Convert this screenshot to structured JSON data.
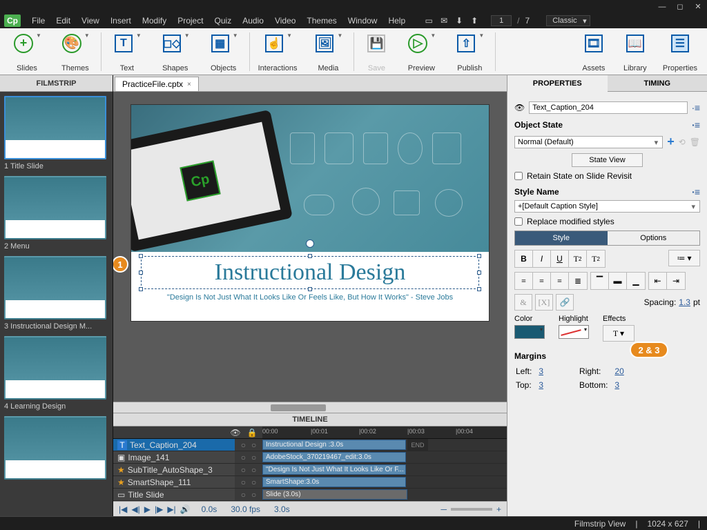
{
  "menu": [
    "File",
    "Edit",
    "View",
    "Insert",
    "Modify",
    "Project",
    "Quiz",
    "Audio",
    "Video",
    "Themes",
    "Window",
    "Help"
  ],
  "page_current": "1",
  "page_total": "7",
  "workspace": "Classic",
  "ribbon": [
    {
      "icon": "plus",
      "label": "Slides",
      "dd": true,
      "style": "circ"
    },
    {
      "icon": "palette",
      "label": "Themes",
      "dd": true,
      "style": "circ"
    },
    {
      "sep": true
    },
    {
      "icon": "T",
      "label": "Text",
      "dd": true,
      "style": "sq"
    },
    {
      "icon": "shapes",
      "label": "Shapes",
      "dd": true,
      "style": "sq"
    },
    {
      "icon": "grid",
      "label": "Objects",
      "dd": true,
      "style": "sq"
    },
    {
      "sep": true
    },
    {
      "icon": "hand",
      "label": "Interactions",
      "dd": true,
      "style": "sq"
    },
    {
      "icon": "img",
      "label": "Media",
      "dd": true,
      "style": "sq"
    },
    {
      "sep": true
    },
    {
      "icon": "save",
      "label": "Save",
      "dd": false,
      "style": "sq",
      "disabled": true
    },
    {
      "icon": "play",
      "label": "Preview",
      "dd": true,
      "style": "circ"
    },
    {
      "icon": "pub",
      "label": "Publish",
      "dd": true,
      "style": "sq"
    },
    {
      "sep": true,
      "flex": true
    },
    {
      "icon": "film",
      "label": "Assets",
      "style": "sq"
    },
    {
      "icon": "book",
      "label": "Library",
      "style": "sq"
    },
    {
      "icon": "menu",
      "label": "Properties",
      "style": "sq",
      "active": true
    }
  ],
  "filmstrip": {
    "header": "FILMSTRIP",
    "slides": [
      {
        "label": "1 Title Slide",
        "sel": true
      },
      {
        "label": "2 Menu"
      },
      {
        "label": "3 Instructional Design M..."
      },
      {
        "label": "4 Learning Design"
      }
    ]
  },
  "tab": {
    "name": "PracticeFile.cptx"
  },
  "stage": {
    "title": "Instructional Design",
    "subtitle": "\"Design Is Not Just What It Looks Like Or Feels Like, But How It Works\" - Steve Jobs"
  },
  "callouts": {
    "c1": "1",
    "c2": "2 & 3"
  },
  "timeline": {
    "header": "TIMELINE",
    "ticks": [
      "00:00",
      "|00:01",
      "|00:02",
      "|00:03",
      "|00:04"
    ],
    "rows": [
      {
        "icon": "T",
        "name": "Text_Caption_204",
        "bar": "Instructional Design :3.0s",
        "sel": true,
        "end": "END"
      },
      {
        "icon": "img",
        "name": "Image_141",
        "bar": "AdobeStock_370219467_edit:3.0s"
      },
      {
        "icon": "star",
        "name": "SubTitle_AutoShape_3",
        "bar": "\"Design Is Not Just What It Looks Like Or F..."
      },
      {
        "icon": "star",
        "name": "SmartShape_111",
        "bar": "SmartShape:3.0s"
      },
      {
        "icon": "slide",
        "name": "Title Slide",
        "bar": "Slide (3.0s)",
        "slide": true
      }
    ],
    "ctrl": {
      "time": "0.0s",
      "fps": "30.0 fps",
      "dur": "3.0s"
    }
  },
  "props": {
    "tabs": [
      "PROPERTIES",
      "TIMING"
    ],
    "active": 0,
    "object_name": "Text_Caption_204",
    "sec_state": "Object State",
    "state_value": "Normal (Default)",
    "state_btn": "State View",
    "retain": "Retain State on Slide Revisit",
    "sec_style": "Style Name",
    "style_value": "+[Default Caption Style]",
    "replace": "Replace modified styles",
    "seg": [
      "Style",
      "Options"
    ],
    "spacing_lbl": "Spacing:",
    "spacing_val": "1.3",
    "spacing_unit": "pt",
    "color_lbl": "Color",
    "hl_lbl": "Highlight",
    "fx_lbl": "Effects",
    "margins_lbl": "Margins",
    "m_left_l": "Left:",
    "m_left": "3",
    "m_right_l": "Right:",
    "m_right": "20",
    "m_top_l": "Top:",
    "m_top": "3",
    "m_bot_l": "Bottom:",
    "m_bot": "3"
  },
  "status": {
    "view": "Filmstrip View",
    "dims": "1024 x 627"
  }
}
